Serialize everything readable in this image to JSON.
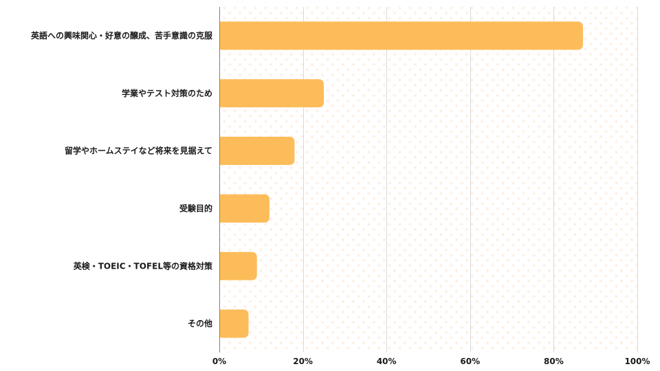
{
  "chart_data": {
    "type": "bar",
    "orientation": "horizontal",
    "title": "",
    "xlabel": "",
    "ylabel": "",
    "categories": [
      "英語への興味関心・好意の醸成、苦手意識の克服",
      "学業やテスト対策のため",
      "留学やホームステイなど将来を見据えて",
      "受験目的",
      "英検・TOEIC・TOFEL等の資格対策",
      "その他"
    ],
    "values": [
      87,
      25,
      18,
      12,
      9,
      7
    ],
    "unit": "%",
    "xlim": [
      0,
      100
    ],
    "x_ticks": [
      0,
      20,
      40,
      60,
      80,
      100
    ],
    "x_tick_labels": [
      "0%",
      "20%",
      "40%",
      "60%",
      "80%",
      "100%"
    ],
    "grid": true,
    "legend": "none",
    "colors": {
      "bar": "#FDBC5A",
      "grid": "#d9d9d9",
      "axis": "#8a7f74",
      "dot_pattern": "#fdeee0",
      "text": "#1a1a1a"
    }
  }
}
